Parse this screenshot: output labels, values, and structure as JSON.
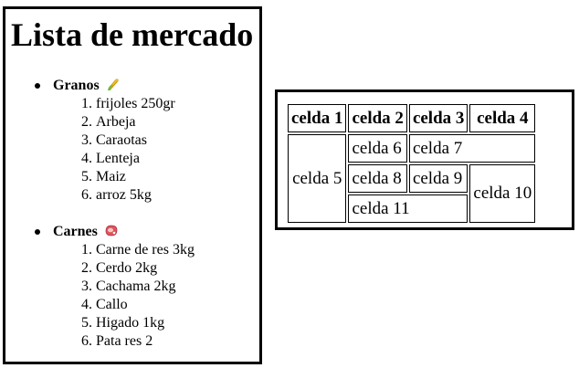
{
  "list": {
    "title": "Lista de mercado",
    "groups": [
      {
        "name": "Granos",
        "icon": "corn-icon",
        "items": [
          "frijoles 250gr",
          "Arbeja",
          "Caraotas",
          "Lenteja",
          "Maiz",
          "arroz 5kg"
        ]
      },
      {
        "name": "Carnes",
        "icon": "meat-icon",
        "items": [
          "Carne de res 3kg",
          "Cerdo 2kg",
          "Cachama 2kg",
          "Callo",
          "Higado 1kg",
          "Pata res 2"
        ]
      }
    ]
  },
  "table": {
    "header": [
      "celda 1",
      "celda 2",
      "celda 3",
      "celda 4"
    ],
    "c5": "celda 5",
    "c6": "celda 6",
    "c7": "celda 7",
    "c8": "celda 8",
    "c9": "celda 9",
    "c10": "celda 10",
    "c11": "celda 11"
  }
}
